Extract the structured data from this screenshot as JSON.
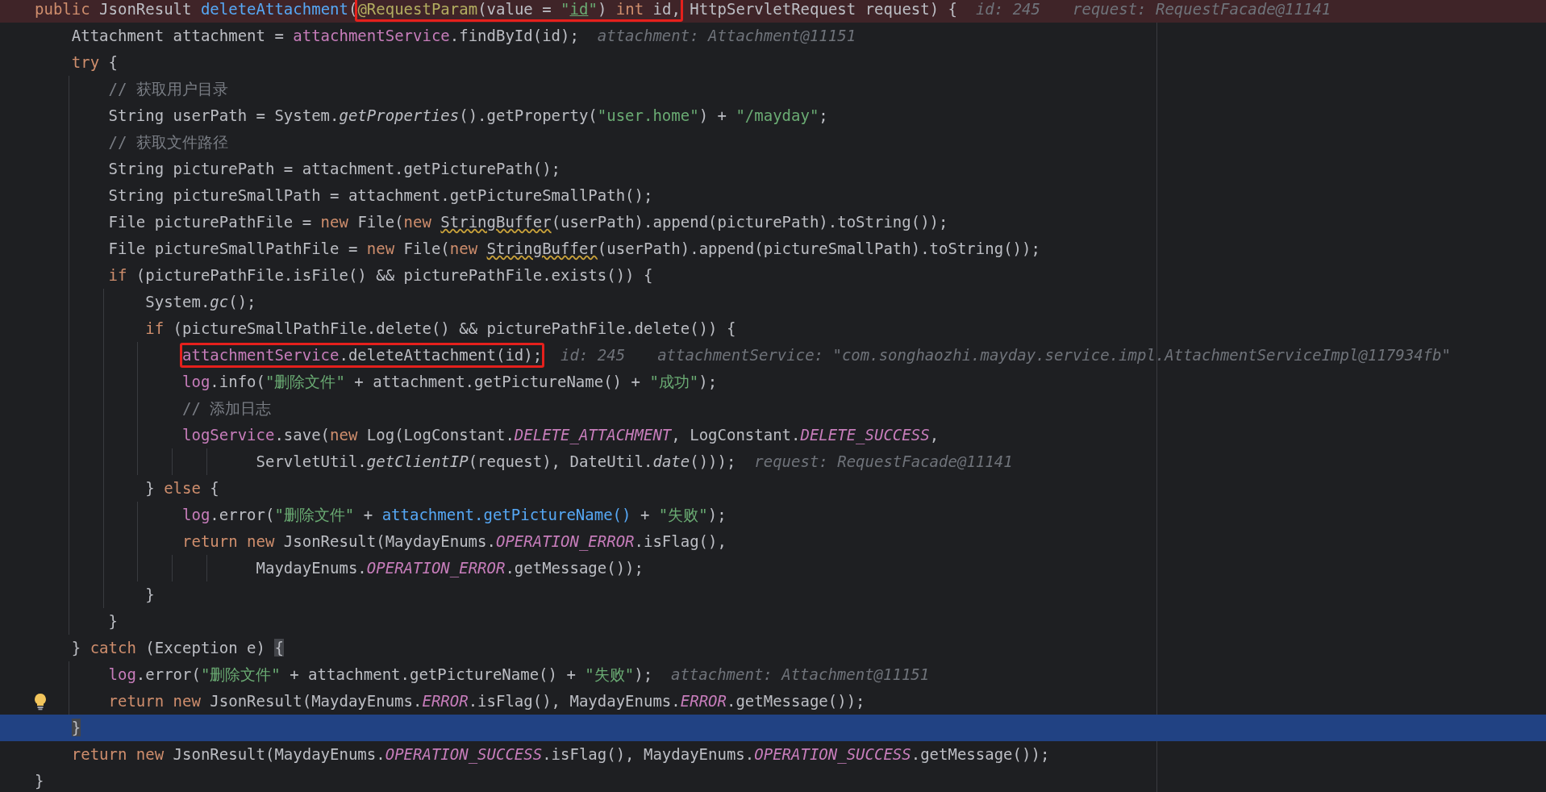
{
  "editor": {
    "lines": [
      {
        "kind": "breakpoint",
        "segments": [
          {
            "kind": "code",
            "tokens": [
              {
                "kind": "kw",
                "text": "public "
              },
              {
                "kind": "plain",
                "text": "JsonResult "
              },
              {
                "kind": "fn",
                "text": "deleteAttachment"
              },
              {
                "kind": "plain",
                "text": "("
              }
            ]
          },
          {
            "kind": "boxed",
            "tokens": [
              {
                "kind": "annotation",
                "text": "@RequestParam"
              },
              {
                "kind": "plain",
                "text": "(value = "
              },
              {
                "kind": "str",
                "text": "\""
              },
              {
                "kind": "str_ref",
                "text": "id"
              },
              {
                "kind": "str",
                "text": "\""
              },
              {
                "kind": "plain",
                "text": ") "
              },
              {
                "kind": "kw",
                "text": "int"
              },
              {
                "kind": "plain",
                "text": " id,"
              }
            ]
          },
          {
            "kind": "code",
            "tokens": [
              {
                "kind": "plain",
                "text": " HttpServletRequest request) {"
              }
            ]
          },
          {
            "kind": "hint",
            "text": "id: 245"
          },
          {
            "kind": "hint",
            "text": "request: RequestFacade@11141"
          }
        ],
        "children": [
          {
            "kind": "normal",
            "segments": [
              {
                "kind": "code",
                "tokens": [
                  {
                    "kind": "plain",
                    "text": "Attachment attachment = "
                  },
                  {
                    "kind": "field",
                    "text": "attachmentService"
                  },
                  {
                    "kind": "plain",
                    "text": ".findById(id);"
                  }
                ]
              },
              {
                "kind": "hint",
                "text": "attachment: Attachment@11151"
              }
            ]
          },
          {
            "kind": "normal",
            "segments": [
              {
                "kind": "code",
                "tokens": [
                  {
                    "kind": "kw",
                    "text": "try"
                  },
                  {
                    "kind": "plain",
                    "text": " {"
                  }
                ]
              }
            ],
            "children": [
              {
                "kind": "normal",
                "segments": [
                  {
                    "kind": "code",
                    "tokens": [
                      {
                        "kind": "comment",
                        "text": "// 获取用户目录"
                      }
                    ]
                  }
                ]
              },
              {
                "kind": "normal",
                "segments": [
                  {
                    "kind": "code",
                    "tokens": [
                      {
                        "kind": "plain",
                        "text": "String userPath = System."
                      },
                      {
                        "kind": "italic",
                        "text": "getProperties"
                      },
                      {
                        "kind": "plain",
                        "text": "().getProperty("
                      },
                      {
                        "kind": "str",
                        "text": "\"user.home\""
                      },
                      {
                        "kind": "plain",
                        "text": ") + "
                      },
                      {
                        "kind": "str",
                        "text": "\"/mayday\""
                      },
                      {
                        "kind": "plain",
                        "text": ";"
                      }
                    ]
                  }
                ]
              },
              {
                "kind": "normal",
                "segments": [
                  {
                    "kind": "code",
                    "tokens": [
                      {
                        "kind": "comment",
                        "text": "// 获取文件路径"
                      }
                    ]
                  }
                ]
              },
              {
                "kind": "normal",
                "segments": [
                  {
                    "kind": "code",
                    "tokens": [
                      {
                        "kind": "plain",
                        "text": "String picturePath = attachment.getPicturePath();"
                      }
                    ]
                  }
                ]
              },
              {
                "kind": "normal",
                "segments": [
                  {
                    "kind": "code",
                    "tokens": [
                      {
                        "kind": "plain",
                        "text": "String pictureSmallPath = attachment.getPictureSmallPath();"
                      }
                    ]
                  }
                ]
              },
              {
                "kind": "normal",
                "segments": [
                  {
                    "kind": "code",
                    "tokens": [
                      {
                        "kind": "plain",
                        "text": "File picturePathFile = "
                      },
                      {
                        "kind": "kw",
                        "text": "new"
                      },
                      {
                        "kind": "plain",
                        "text": " File("
                      },
                      {
                        "kind": "kw",
                        "text": "new "
                      },
                      {
                        "kind": "warn",
                        "text": "StringBuffer"
                      },
                      {
                        "kind": "plain",
                        "text": "(userPath).append(picturePath).toString());"
                      }
                    ]
                  }
                ]
              },
              {
                "kind": "normal",
                "segments": [
                  {
                    "kind": "code",
                    "tokens": [
                      {
                        "kind": "plain",
                        "text": "File pictureSmallPathFile = "
                      },
                      {
                        "kind": "kw",
                        "text": "new"
                      },
                      {
                        "kind": "plain",
                        "text": " File("
                      },
                      {
                        "kind": "kw",
                        "text": "new "
                      },
                      {
                        "kind": "warn",
                        "text": "StringBuffer"
                      },
                      {
                        "kind": "plain",
                        "text": "(userPath).append(pictureSmallPath).toString());"
                      }
                    ]
                  }
                ]
              },
              {
                "kind": "normal",
                "segments": [
                  {
                    "kind": "code",
                    "tokens": [
                      {
                        "kind": "kw",
                        "text": "if"
                      },
                      {
                        "kind": "plain",
                        "text": " (picturePathFile.isFile() && picturePathFile.exists()) {"
                      }
                    ]
                  }
                ],
                "children": [
                  {
                    "kind": "normal",
                    "segments": [
                      {
                        "kind": "code",
                        "tokens": [
                          {
                            "kind": "plain",
                            "text": "System."
                          },
                          {
                            "kind": "italic",
                            "text": "gc"
                          },
                          {
                            "kind": "plain",
                            "text": "();"
                          }
                        ]
                      }
                    ]
                  },
                  {
                    "kind": "normal",
                    "segments": [
                      {
                        "kind": "code",
                        "tokens": [
                          {
                            "kind": "kw",
                            "text": "if"
                          },
                          {
                            "kind": "plain",
                            "text": " (pictureSmallPathFile.delete() && picturePathFile.delete()) {"
                          }
                        ]
                      }
                    ],
                    "children": [
                      {
                        "kind": "normal",
                        "segments": [
                          {
                            "kind": "boxed",
                            "tokens": [
                              {
                                "kind": "field",
                                "text": "attachmentService"
                              },
                              {
                                "kind": "plain",
                                "text": ".deleteAttachment(id);"
                              }
                            ]
                          },
                          {
                            "kind": "hint",
                            "text": "id: 245"
                          },
                          {
                            "kind": "hint",
                            "text": "attachmentService: \"com.songhaozhi.mayday.service.impl.AttachmentServiceImpl@117934fb\""
                          }
                        ]
                      },
                      {
                        "kind": "normal",
                        "segments": [
                          {
                            "kind": "code",
                            "tokens": [
                              {
                                "kind": "field",
                                "text": "log"
                              },
                              {
                                "kind": "plain",
                                "text": ".info("
                              },
                              {
                                "kind": "str",
                                "text": "\"删除文件\""
                              },
                              {
                                "kind": "plain",
                                "text": " + attachment.getPictureName() + "
                              },
                              {
                                "kind": "str",
                                "text": "\"成功\""
                              },
                              {
                                "kind": "plain",
                                "text": ");"
                              }
                            ]
                          }
                        ]
                      },
                      {
                        "kind": "normal",
                        "segments": [
                          {
                            "kind": "code",
                            "tokens": [
                              {
                                "kind": "comment",
                                "text": "// 添加日志"
                              }
                            ]
                          }
                        ]
                      },
                      {
                        "kind": "normal",
                        "segments": [
                          {
                            "kind": "code",
                            "tokens": [
                              {
                                "kind": "field",
                                "text": "logService"
                              },
                              {
                                "kind": "plain",
                                "text": ".save("
                              },
                              {
                                "kind": "kw",
                                "text": "new"
                              },
                              {
                                "kind": "plain",
                                "text": " Log(LogConstant."
                              },
                              {
                                "kind": "const",
                                "text": "DELETE_ATTACHMENT"
                              },
                              {
                                "kind": "plain",
                                "text": ", LogConstant."
                              },
                              {
                                "kind": "const",
                                "text": "DELETE_SUCCESS"
                              },
                              {
                                "kind": "plain",
                                "text": ","
                              }
                            ]
                          }
                        ],
                        "children": [
                          {
                            "kind": "continuation",
                            "segments": [
                              {
                                "kind": "code",
                                "tokens": [
                                  {
                                    "kind": "plain",
                                    "text": "ServletUtil."
                                  },
                                  {
                                    "kind": "italic",
                                    "text": "getClientIP"
                                  },
                                  {
                                    "kind": "plain",
                                    "text": "(request), DateUtil."
                                  },
                                  {
                                    "kind": "italic",
                                    "text": "date"
                                  },
                                  {
                                    "kind": "plain",
                                    "text": "()));"
                                  }
                                ]
                              },
                              {
                                "kind": "hint",
                                "text": "request: RequestFacade@11141"
                              }
                            ]
                          }
                        ]
                      }
                    ]
                  },
                  {
                    "kind": "normal",
                    "segments": [
                      {
                        "kind": "code",
                        "tokens": [
                          {
                            "kind": "plain",
                            "text": "} "
                          },
                          {
                            "kind": "kw",
                            "text": "else"
                          },
                          {
                            "kind": "plain",
                            "text": " {"
                          }
                        ]
                      }
                    ],
                    "children": [
                      {
                        "kind": "normal",
                        "segments": [
                          {
                            "kind": "code",
                            "tokens": [
                              {
                                "kind": "field",
                                "text": "log"
                              },
                              {
                                "kind": "plain",
                                "text": ".error("
                              },
                              {
                                "kind": "str",
                                "text": "\"删除文件\""
                              },
                              {
                                "kind": "plain",
                                "text": " + "
                              },
                              {
                                "kind": "link",
                                "text": "attachment.getPictureName()"
                              },
                              {
                                "kind": "plain",
                                "text": " + "
                              },
                              {
                                "kind": "str",
                                "text": "\"失败\""
                              },
                              {
                                "kind": "plain",
                                "text": ");"
                              }
                            ]
                          }
                        ]
                      },
                      {
                        "kind": "normal",
                        "segments": [
                          {
                            "kind": "code",
                            "tokens": [
                              {
                                "kind": "kw",
                                "text": "return new"
                              },
                              {
                                "kind": "plain",
                                "text": " JsonResult(MaydayEnums."
                              },
                              {
                                "kind": "const",
                                "text": "OPERATION_ERROR"
                              },
                              {
                                "kind": "plain",
                                "text": ".isFlag(),"
                              }
                            ]
                          }
                        ],
                        "children": [
                          {
                            "kind": "continuation",
                            "segments": [
                              {
                                "kind": "code",
                                "tokens": [
                                  {
                                    "kind": "plain",
                                    "text": "MaydayEnums."
                                  },
                                  {
                                    "kind": "const",
                                    "text": "OPERATION_ERROR"
                                  },
                                  {
                                    "kind": "plain",
                                    "text": ".getMessage());"
                                  }
                                ]
                              }
                            ]
                          }
                        ]
                      }
                    ]
                  },
                  {
                    "kind": "normal",
                    "segments": [
                      {
                        "kind": "code",
                        "tokens": [
                          {
                            "kind": "plain",
                            "text": "}"
                          }
                        ]
                      }
                    ]
                  }
                ]
              },
              {
                "kind": "normal",
                "segments": [
                  {
                    "kind": "code",
                    "tokens": [
                      {
                        "kind": "plain",
                        "text": "}"
                      }
                    ]
                  }
                ]
              }
            ]
          },
          {
            "kind": "normal",
            "segments": [
              {
                "kind": "code",
                "tokens": [
                  {
                    "kind": "plain",
                    "text": "} "
                  },
                  {
                    "kind": "kw",
                    "text": "catch"
                  },
                  {
                    "kind": "plain",
                    "text": " (Exception e) "
                  },
                  {
                    "kind": "brace",
                    "text": "{"
                  }
                ]
              }
            ],
            "children": [
              {
                "kind": "normal",
                "segments": [
                  {
                    "kind": "code",
                    "tokens": [
                      {
                        "kind": "field",
                        "text": "log"
                      },
                      {
                        "kind": "plain",
                        "text": ".error("
                      },
                      {
                        "kind": "str",
                        "text": "\"删除文件\""
                      },
                      {
                        "kind": "plain",
                        "text": " + attachment.getPictureName() + "
                      },
                      {
                        "kind": "str",
                        "text": "\"失败\""
                      },
                      {
                        "kind": "plain",
                        "text": ");"
                      }
                    ]
                  },
                  {
                    "kind": "hint",
                    "text": "attachment: Attachment@11151"
                  }
                ]
              },
              {
                "kind": "normal",
                "bulb": true,
                "segments": [
                  {
                    "kind": "code",
                    "tokens": [
                      {
                        "kind": "kw",
                        "text": "return new"
                      },
                      {
                        "kind": "plain",
                        "text": " JsonResult(MaydayEnums."
                      },
                      {
                        "kind": "const",
                        "text": "ERROR"
                      },
                      {
                        "kind": "plain",
                        "text": ".isFlag(), MaydayEnums."
                      },
                      {
                        "kind": "const",
                        "text": "ERROR"
                      },
                      {
                        "kind": "plain",
                        "text": ".getMessage());"
                      }
                    ]
                  }
                ]
              }
            ]
          },
          {
            "kind": "current",
            "segments": [
              {
                "kind": "code",
                "tokens": [
                  {
                    "kind": "brace",
                    "text": "}"
                  }
                ]
              }
            ]
          },
          {
            "kind": "normal",
            "segments": [
              {
                "kind": "code",
                "tokens": [
                  {
                    "kind": "kw",
                    "text": "return new"
                  },
                  {
                    "kind": "plain",
                    "text": " JsonResult(MaydayEnums."
                  },
                  {
                    "kind": "const",
                    "text": "OPERATION_SUCCESS"
                  },
                  {
                    "kind": "plain",
                    "text": ".isFlag(), MaydayEnums."
                  },
                  {
                    "kind": "const",
                    "text": "OPERATION_SUCCESS"
                  },
                  {
                    "kind": "plain",
                    "text": ".getMessage());"
                  }
                ]
              }
            ]
          }
        ]
      },
      {
        "kind": "normal",
        "segments": [
          {
            "kind": "code",
            "tokens": [
              {
                "kind": "plain",
                "text": "}"
              }
            ]
          }
        ]
      }
    ]
  }
}
